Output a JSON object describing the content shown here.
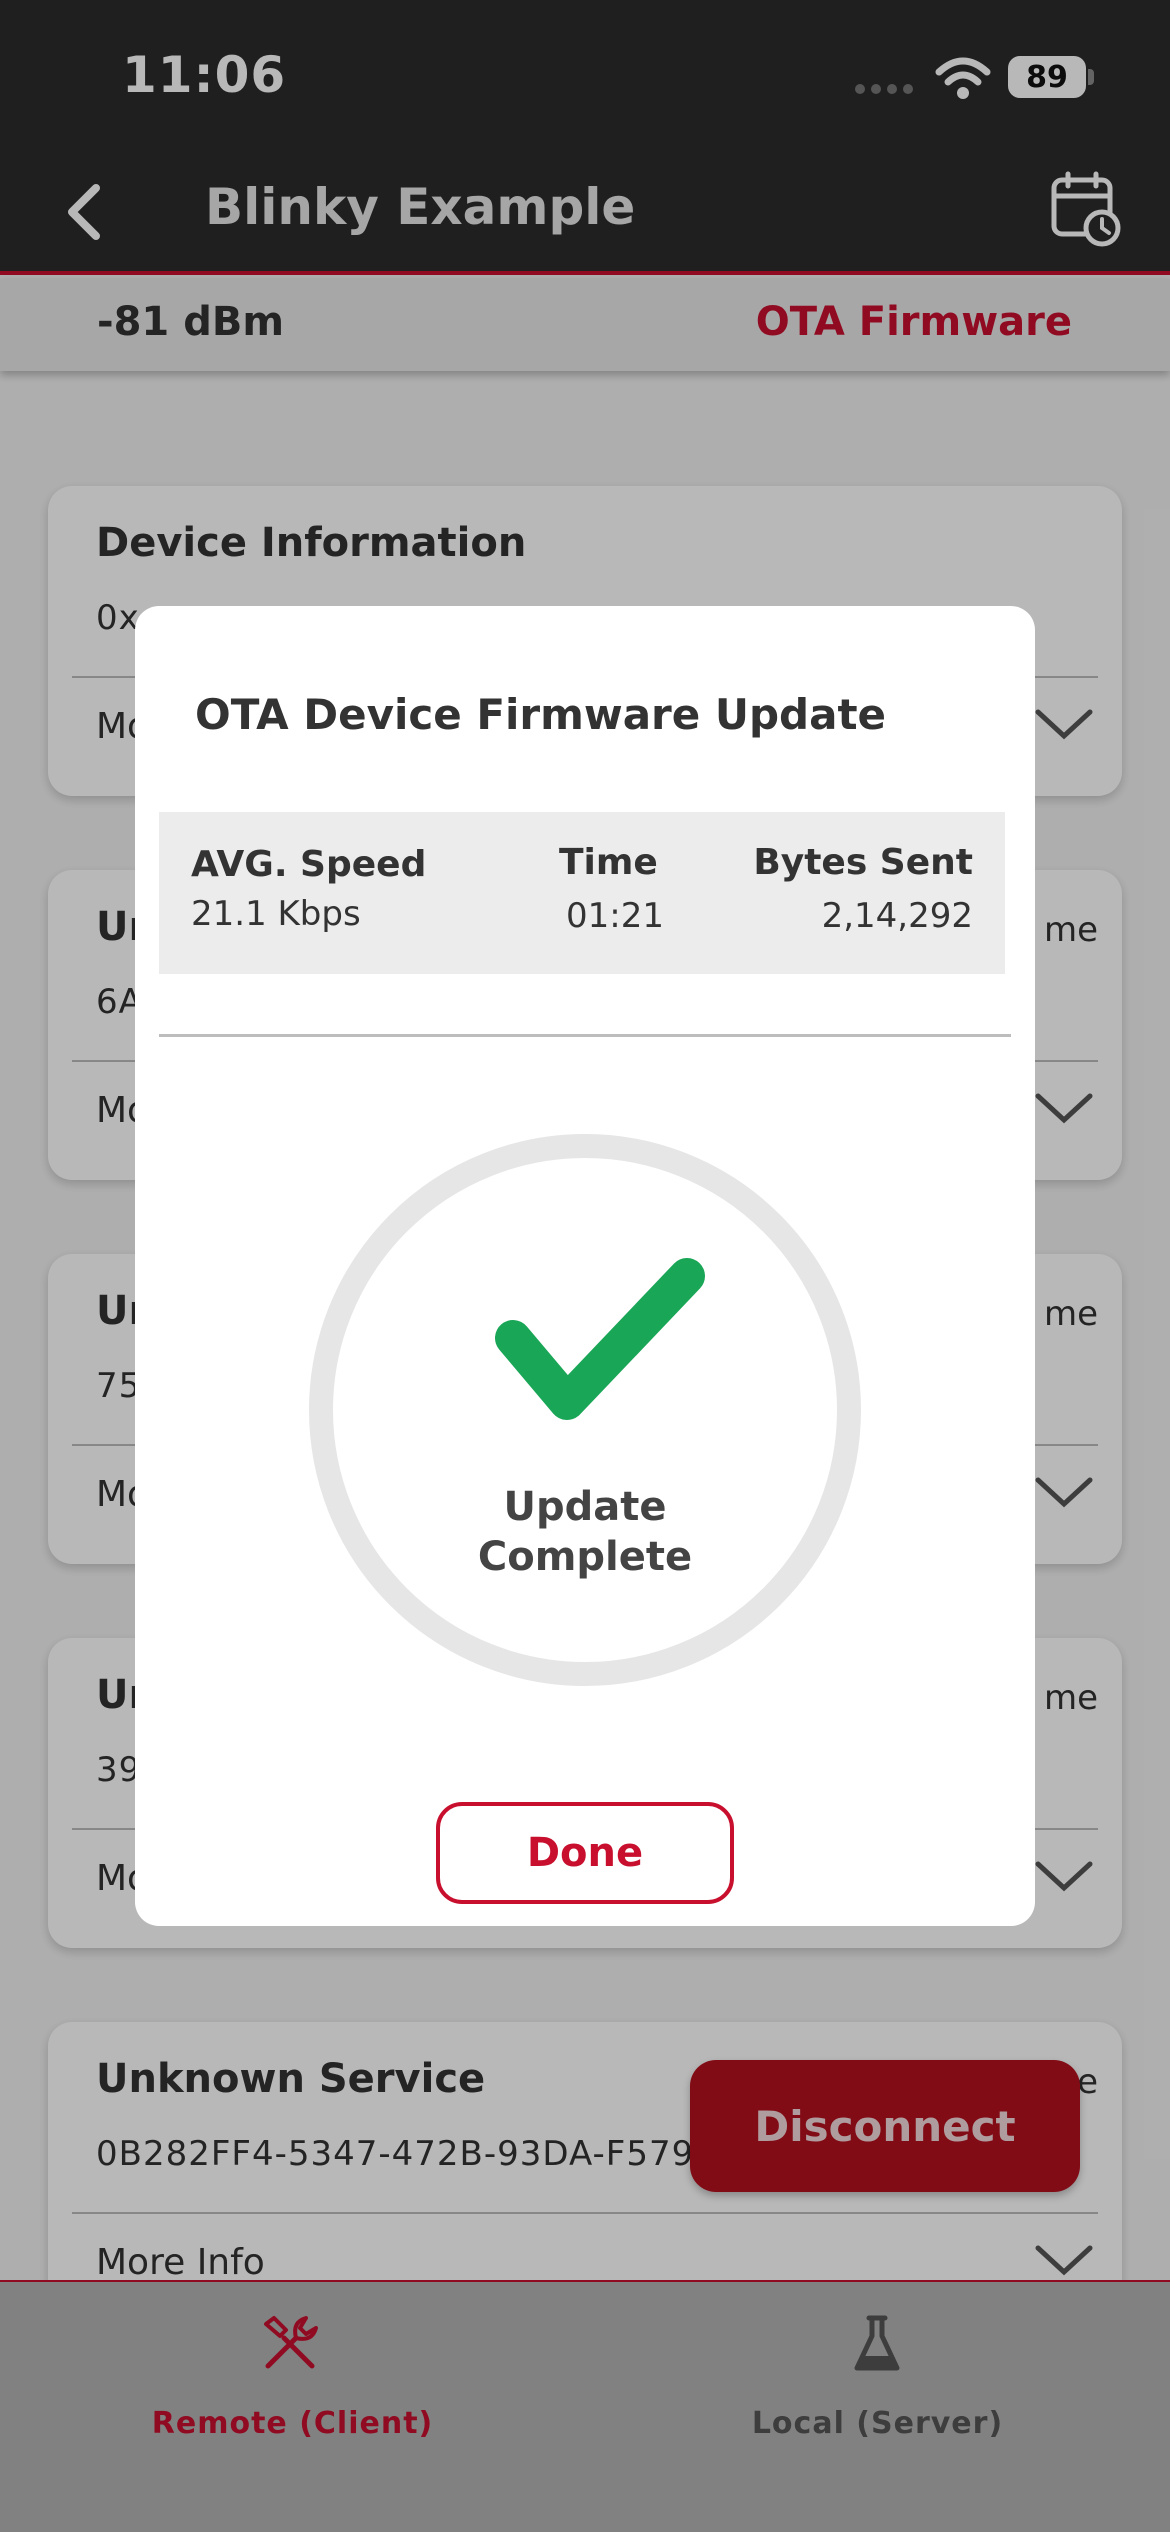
{
  "status_bar": {
    "time": "11:06",
    "battery": "89"
  },
  "nav": {
    "title": "Blinky Example"
  },
  "info_bar": {
    "rssi": "-81 dBm",
    "ota_link": "OTA Firmware"
  },
  "cards": [
    {
      "title": "Device Information",
      "uuid": "0x",
      "more": "Mo",
      "rename": ""
    },
    {
      "title": "Ur",
      "uuid": "6A",
      "more": "Mo",
      "rename": "me"
    },
    {
      "title": "Ur",
      "uuid": "75",
      "more": "Mo",
      "rename": "me"
    },
    {
      "title": "Ur",
      "uuid": "39",
      "more": "Mo",
      "rename": "me"
    },
    {
      "title": "Unknown Service",
      "uuid": "0B282FF4-5347-472B-93DA-F579",
      "more": "More Info",
      "rename": "e"
    }
  ],
  "dialog": {
    "title": "OTA Device Firmware Update",
    "avg_speed_label": "AVG. Speed",
    "avg_speed_value": "21.1 Kbps",
    "time_label": "Time",
    "time_value": "01:21",
    "bytes_label": "Bytes Sent",
    "bytes_value": "2,14,292",
    "status_line1": "Update",
    "status_line2": "Complete",
    "progress": 1.0,
    "done_label": "Done"
  },
  "disconnect_label": "Disconnect",
  "tabs": [
    {
      "label": "Remote (Client)",
      "icon": "tools-icon",
      "active": true
    },
    {
      "label": "Local (Server)",
      "icon": "flask-icon",
      "active": false
    }
  ],
  "colors": {
    "accent": "#c8102e",
    "success": "#1aa657",
    "navbar": "#2b2b2b"
  }
}
